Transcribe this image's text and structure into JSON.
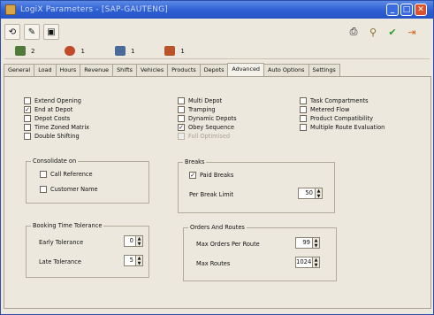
{
  "window": {
    "title": "LogiX Parameters - [SAP-GAUTENG]",
    "min": "_",
    "max": "□",
    "close": "✕"
  },
  "toolbar": {
    "left": [
      {
        "name": "undo-button",
        "glyph": "⟲"
      },
      {
        "name": "pin-button",
        "glyph": "✎"
      },
      {
        "name": "save-button",
        "glyph": "▣"
      }
    ],
    "right": [
      {
        "name": "print-button",
        "glyph": "⎙"
      },
      {
        "name": "filter-button",
        "glyph": "⚲"
      },
      {
        "name": "accept-button",
        "glyph": "✔"
      },
      {
        "name": "exit-button",
        "glyph": "⇥"
      }
    ]
  },
  "counts": [
    {
      "name": "depots",
      "value": "2",
      "color": "#4f7a3a"
    },
    {
      "name": "customers",
      "value": "1",
      "color": "#c04a2a"
    },
    {
      "name": "vehicles",
      "value": "1",
      "color": "#4a6a9a"
    },
    {
      "name": "products",
      "value": "1",
      "color": "#b9532a"
    }
  ],
  "tabs": [
    "General",
    "Load",
    "Hours",
    "Revenue",
    "Shifts",
    "Vehicles",
    "Products",
    "Depots",
    "Advanced",
    "Auto Options",
    "Settings"
  ],
  "active_tab": "Advanced",
  "options": {
    "col1": [
      {
        "label": "Extend Opening",
        "checked": false
      },
      {
        "label": "End at Depot",
        "checked": true
      },
      {
        "label": "Depot Costs",
        "checked": false
      },
      {
        "label": "Time Zoned Matrix",
        "checked": false
      },
      {
        "label": "Double Shifting",
        "checked": false
      }
    ],
    "col2": [
      {
        "label": "Multi Depot",
        "checked": false
      },
      {
        "label": "Tramping",
        "checked": false
      },
      {
        "label": "Dynamic Depots",
        "checked": false
      },
      {
        "label": "Obey Sequence",
        "checked": true
      },
      {
        "label": "Full Optimised",
        "checked": false,
        "disabled": true
      }
    ],
    "col3": [
      {
        "label": "Task Compartments",
        "checked": false
      },
      {
        "label": "Metered Flow",
        "checked": false
      },
      {
        "label": "Product Compatibility",
        "checked": false
      },
      {
        "label": "Multiple Route Evaluation",
        "checked": false
      }
    ]
  },
  "consolidate": {
    "title": "Consolidate on",
    "items": [
      {
        "label": "Call Reference",
        "checked": false
      },
      {
        "label": "Customer Name",
        "checked": false
      }
    ]
  },
  "breaks": {
    "title": "Breaks",
    "paid_label": "Paid Breaks",
    "paid_checked": true,
    "limit_label": "Per Break Limit",
    "limit_value": "50"
  },
  "booking": {
    "title": "Booking Time Tolerance",
    "early_label": "Early Tolerance",
    "early_value": "0",
    "late_label": "Late Tolerance",
    "late_value": "5"
  },
  "orders": {
    "title": "Orders And Routes",
    "max_orders_label": "Max Orders Per Route",
    "max_orders_value": "99",
    "max_routes_label": "Max Routes",
    "max_routes_value": "1024"
  }
}
